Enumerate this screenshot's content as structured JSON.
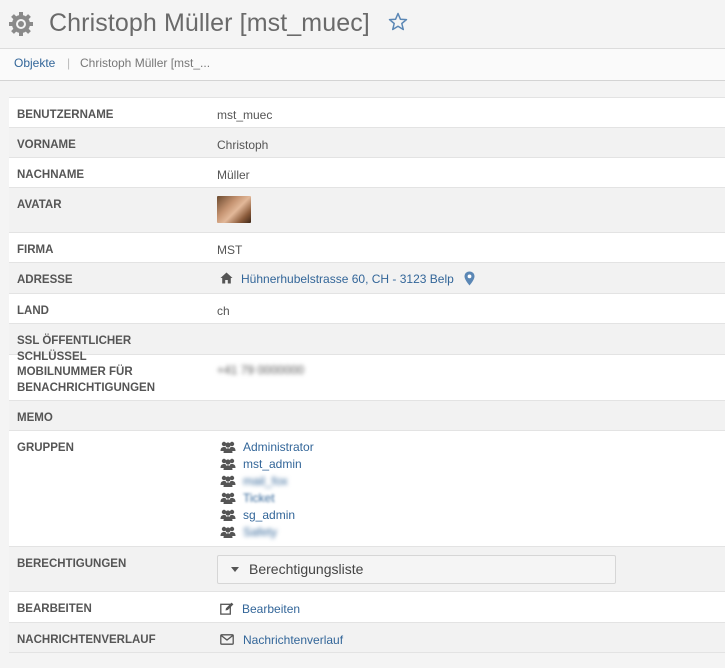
{
  "header": {
    "title": "Christoph Müller [mst_muec]"
  },
  "breadcrumb": {
    "link": "Objekte",
    "separator": "|",
    "current": "Christoph Müller [mst_..."
  },
  "fields": {
    "username": {
      "label": "BENUTZERNAME",
      "value": "mst_muec"
    },
    "firstname": {
      "label": "VORNAME",
      "value": "Christoph"
    },
    "lastname": {
      "label": "NACHNAME",
      "value": "Müller"
    },
    "avatar": {
      "label": "AVATAR"
    },
    "company": {
      "label": "FIRMA",
      "value": "MST"
    },
    "address": {
      "label": "ADRESSE",
      "value": "Hühnerhubelstrasse 60, CH - 3123 Belp"
    },
    "country": {
      "label": "LAND",
      "value": "ch"
    },
    "ssl": {
      "label": "SSL ÖFFENTLICHER SCHLÜSSEL"
    },
    "mobile": {
      "label": "MOBILNUMMER FÜR BENACHRICHTIGUNGEN",
      "value": "+41 79 0000000"
    },
    "memo": {
      "label": "MEMO"
    },
    "groups": {
      "label": "GRUPPEN",
      "items": [
        "Administrator",
        "mst_admin",
        "mail_fox",
        "Ticket",
        "sg_admin",
        "Safety"
      ]
    },
    "permissions": {
      "label": "BERECHTIGUNGEN",
      "button": "Berechtigungsliste"
    },
    "edit": {
      "label": "BEARBEITEN",
      "link": "Bearbeiten"
    },
    "history": {
      "label": "NACHRICHTENVERLAUF",
      "link": "Nachrichtenverlauf"
    }
  },
  "colors": {
    "link": "#336699",
    "label": "#555555",
    "alt_row": "#f2f2f2"
  }
}
